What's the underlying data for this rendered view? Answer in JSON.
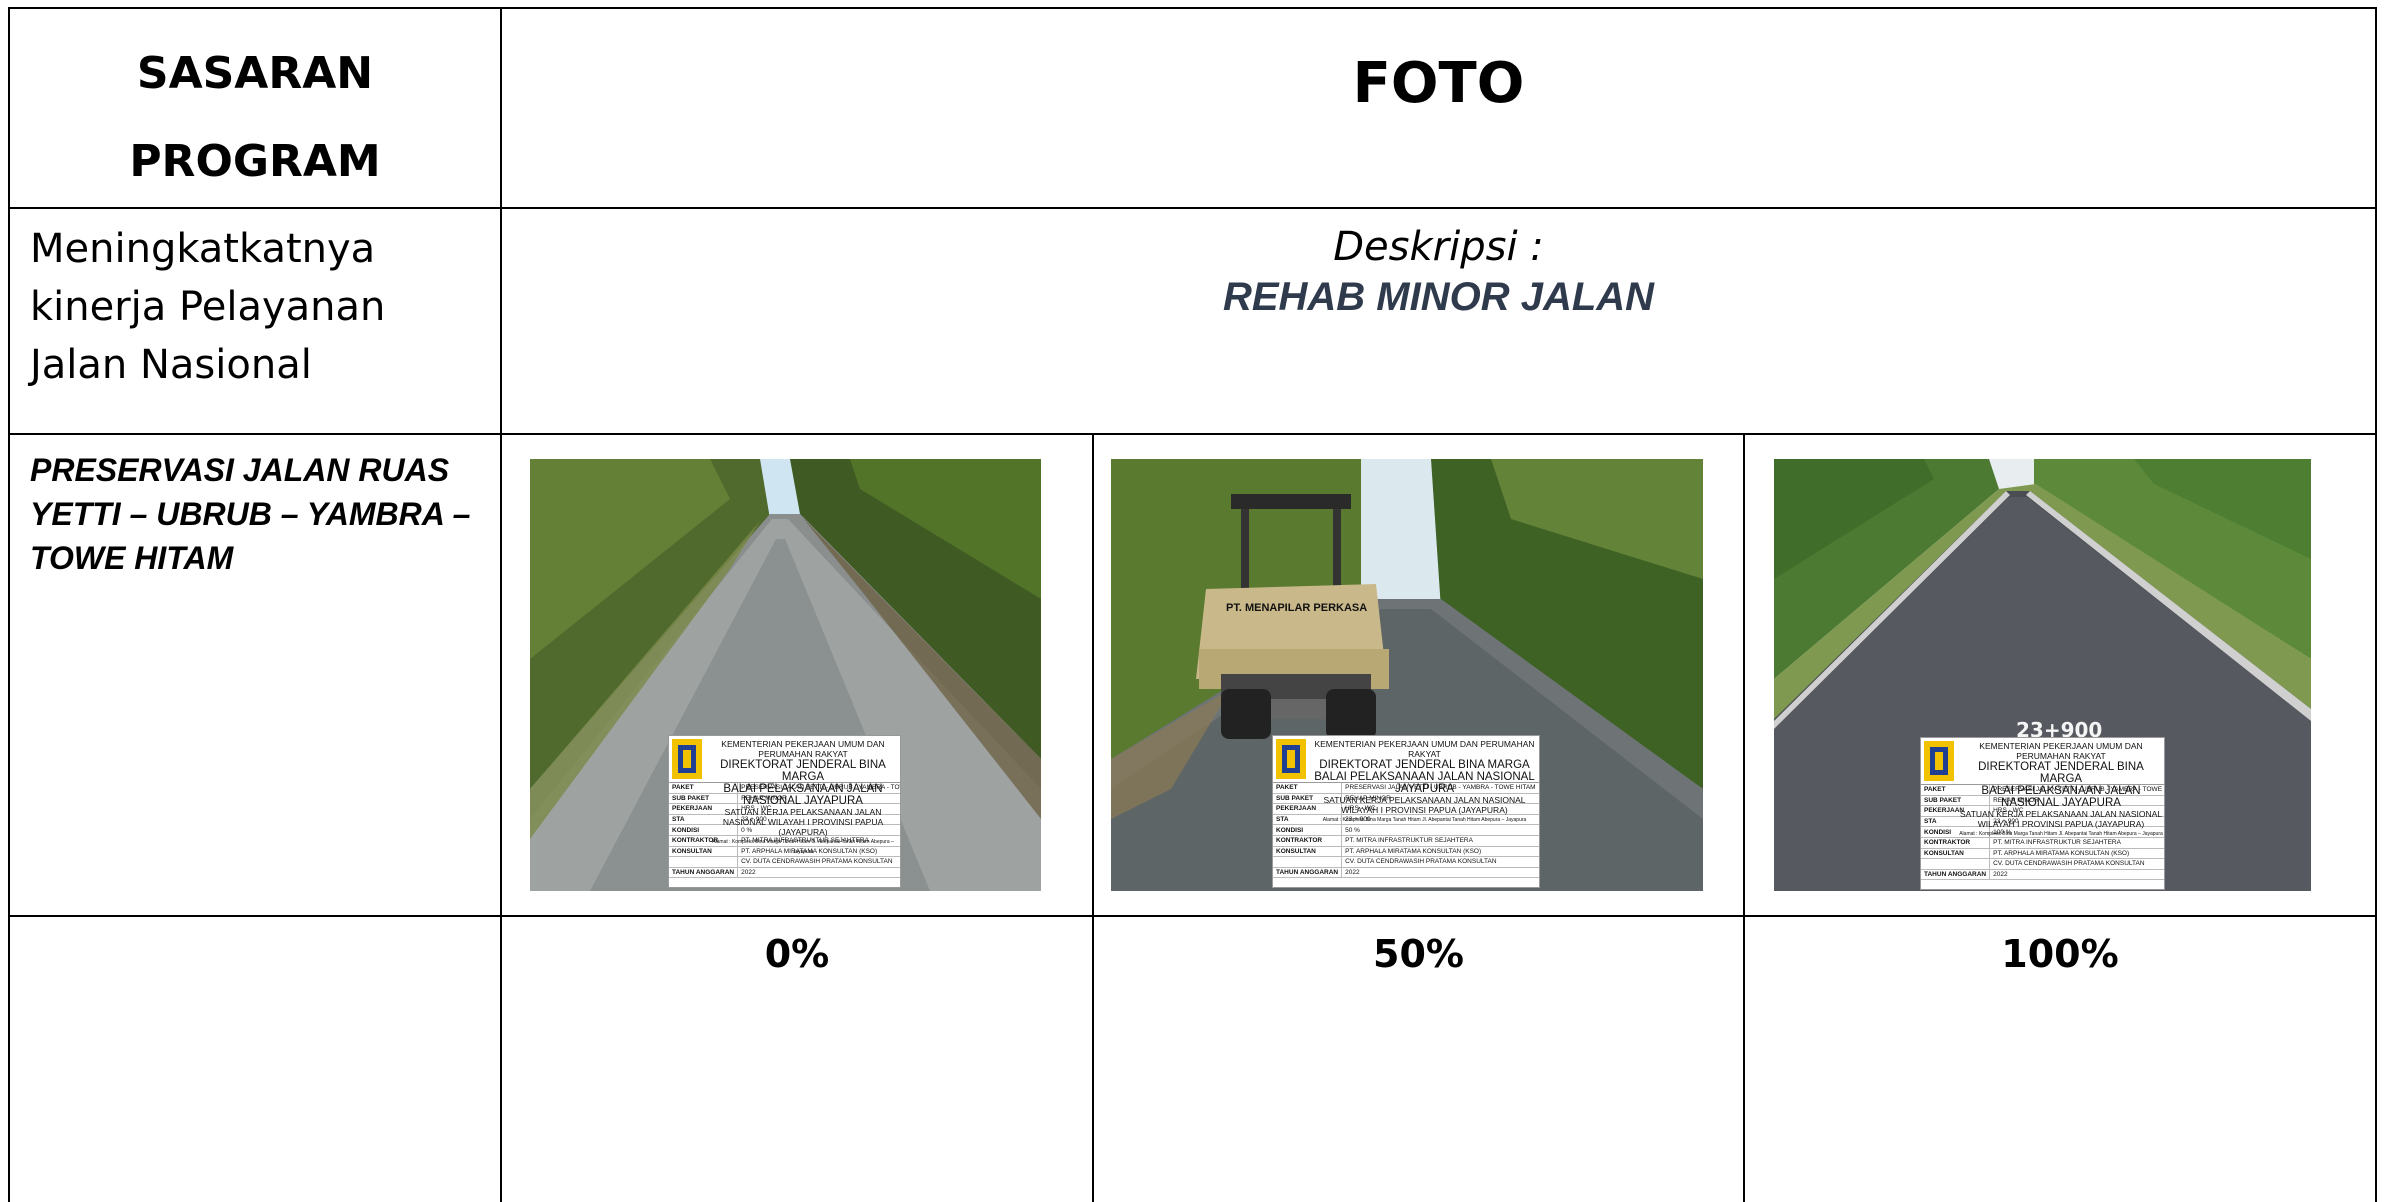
{
  "header": {
    "col1_line1": "SASARAN",
    "col1_line2": "PROGRAM",
    "col2": "FOTO"
  },
  "row_target": {
    "text_lines": [
      "Meningkatkatnya",
      "kinerja Pelayanan",
      "Jalan Nasional"
    ],
    "desc_label": "Deskripsi :",
    "desc_value": "REHAB MINOR JALAN"
  },
  "row_photos": {
    "project_lines": [
      "PRESERVASI JALAN RUAS",
      "YETTI – UBRUB – YAMBRA –",
      "TOWE HITAM"
    ],
    "photos": [
      {
        "scene": "road-before-work",
        "progress_label": "0%",
        "progress": 0,
        "board_kondisi": "0 %",
        "sta_mark": ""
      },
      {
        "scene": "road-roller-on-road",
        "progress_label": "50%",
        "progress": 50,
        "board_kondisi": "50 %",
        "sta_mark": ""
      },
      {
        "scene": "road-finished-asphalt",
        "progress_label": "100%",
        "progress": 100,
        "board_kondisi": "100 %",
        "sta_mark": "23+900"
      }
    ]
  },
  "roller_text": "PT. MENAPILAR PERKASA",
  "board": {
    "org1": "KEMENTERIAN PEKERJAAN UMUM DAN PERUMAHAN RAKYAT",
    "org2": "DIREKTORAT JENDERAL BINA MARGA",
    "org3": "BALAI PELAKSANAAN JALAN NASIONAL JAYAPURA",
    "org4": "SATUAN KERJA PELAKSANAAN JALAN NASIONAL WILAYAH I PROVINSI PAPUA (JAYAPURA)",
    "address": "Alamat : Kompleks Bina Marga Tanah Hitam Jl. Abepantai Tanah Hitam Abepura – Jayapura",
    "rows": [
      {
        "k": "PAKET",
        "v": "PRESERVASI JALAN YETTI - UBRUB - YAMBRA - TOWE HITAM"
      },
      {
        "k": "SUB PAKET",
        "v": "REHAP MINOR"
      },
      {
        "k": "PEKERJAAN",
        "v": "HRS - WC"
      },
      {
        "k": "STA",
        "v": "23 + 900"
      },
      {
        "k": "KONDISI",
        "v": ""
      },
      {
        "k": "KONTRAKTOR",
        "v": "PT. MITRA INFRASTRUKTUR SEJAHTERA"
      },
      {
        "k": "KONSULTAN",
        "v": "PT. ARPHALA MIRATAMA KONSULTAN (KSO)"
      },
      {
        "k": "",
        "v": "CV. DUTA CENDRAWASIH PRATAMA KONSULTAN"
      },
      {
        "k": "TAHUN ANGGARAN",
        "v": "2022"
      }
    ]
  },
  "colors": {
    "border": "#000000",
    "desc_value": "#2f3b4c",
    "logo_yellow": "#f2c200",
    "logo_blue": "#1f3f93"
  }
}
